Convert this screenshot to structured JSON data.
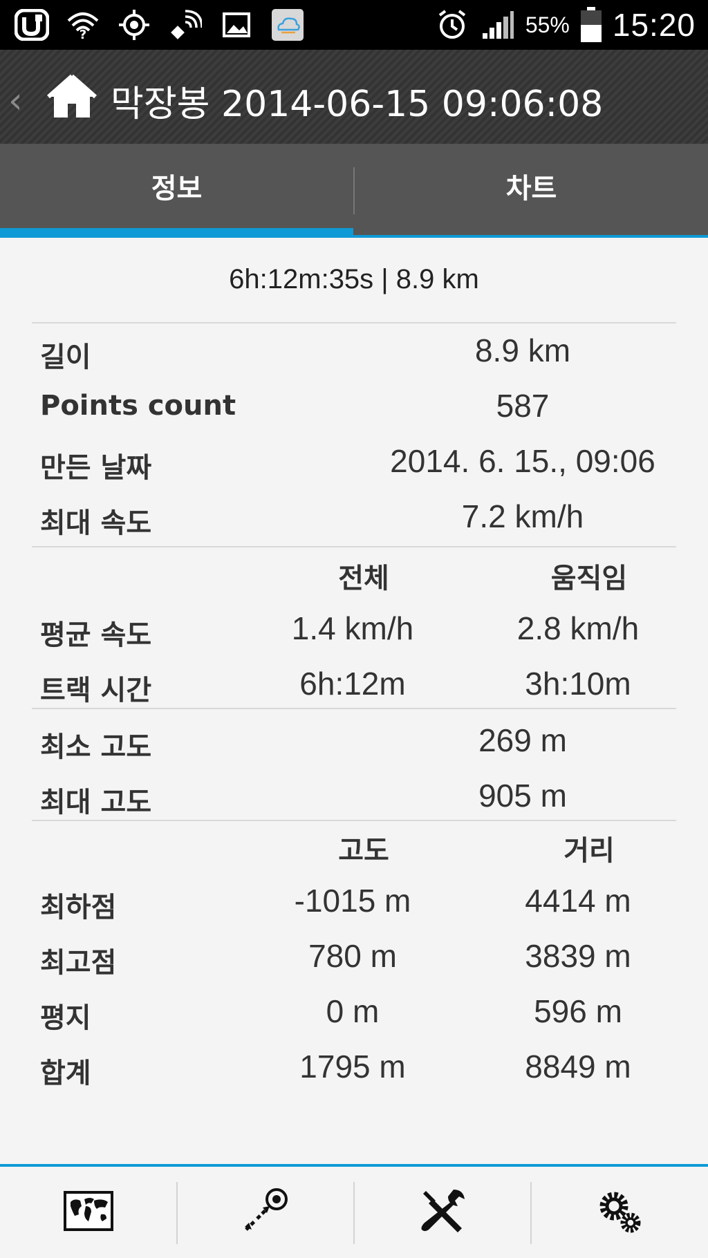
{
  "status_bar": {
    "battery_percent": "55%",
    "clock": "15:20",
    "icons": [
      "u-plus-icon",
      "wifi-question-icon",
      "gps-icon",
      "satellite-icon",
      "image-icon",
      "weather-cloud-icon",
      "alarm-icon",
      "signal-icon",
      "battery-icon"
    ]
  },
  "action_bar": {
    "back_icon": "chevron-left-icon",
    "home_icon": "home-icon",
    "title": "막장봉 2014-06-15 09:06:08"
  },
  "tabs": [
    {
      "label": "정보",
      "active": true
    },
    {
      "label": "차트",
      "active": false
    }
  ],
  "summary": "6h:12m:35s | 8.9 km",
  "stats": {
    "length": {
      "label": "길이",
      "value": "8.9 km"
    },
    "points": {
      "label": "Points count",
      "value": "587"
    },
    "created": {
      "label": "만든 날짜",
      "value": "2014. 6. 15., 09:06"
    },
    "max_speed": {
      "label": "최대 속도",
      "value": "7.2 km/h"
    }
  },
  "speed_table": {
    "headers": [
      "전체",
      "움직임"
    ],
    "rows": [
      {
        "label": "평균 속도",
        "total": "1.4 km/h",
        "moving": "2.8 km/h"
      },
      {
        "label": "트랙 시간",
        "total": "6h:12m",
        "moving": "3h:10m"
      }
    ]
  },
  "altitude": {
    "min": {
      "label": "최소 고도",
      "value": "269 m"
    },
    "max": {
      "label": "최대 고도",
      "value": "905 m"
    }
  },
  "elevation_table": {
    "headers": [
      "고도",
      "거리"
    ],
    "rows": [
      {
        "label": "최하점",
        "alt": "-1015 m",
        "dist": "4414 m"
      },
      {
        "label": "최고점",
        "alt": "780 m",
        "dist": "3839 m"
      },
      {
        "label": "평지",
        "alt": "0 m",
        "dist": "596 m"
      },
      {
        "label": "합계",
        "alt": "1795 m",
        "dist": "8849 m"
      }
    ]
  },
  "bottom_bar": {
    "buttons": [
      "world-map-icon",
      "route-target-icon",
      "tools-icon",
      "settings-gears-icon"
    ]
  },
  "colors": {
    "accent": "#0e9ad6",
    "tab_bg": "#555555",
    "background": "#f4f4f4"
  }
}
